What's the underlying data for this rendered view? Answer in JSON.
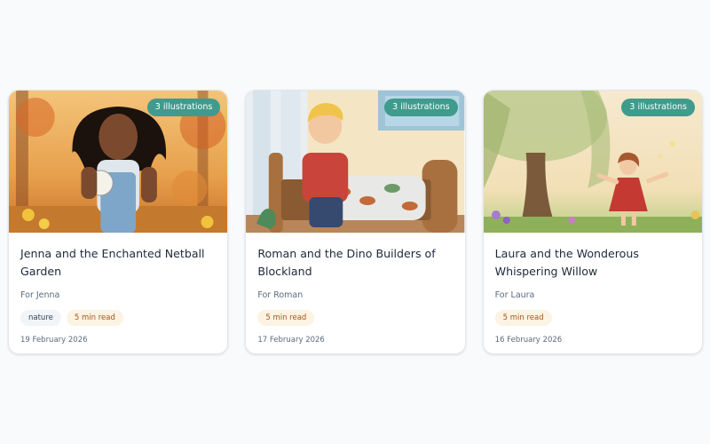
{
  "stories": [
    {
      "badge": "3 illustrations",
      "title": "Jenna and the Enchanted Netball Garden",
      "for_label": "For Jenna",
      "tags": [
        "nature",
        "5 min read"
      ],
      "date": "19 February 2026",
      "image_icon": "girl-with-netball-illustration"
    },
    {
      "badge": "3 illustrations",
      "title": "Roman and the Dino Builders of Blockland",
      "for_label": "For Roman",
      "tags": [
        "5 min read"
      ],
      "date": "17 February 2026",
      "image_icon": "boy-making-bed-illustration"
    },
    {
      "badge": "3 illustrations",
      "title": "Laura and the Wonderous Whispering Willow",
      "for_label": "For Laura",
      "tags": [
        "5 min read"
      ],
      "date": "16 February 2026",
      "image_icon": "girl-under-willow-illustration"
    }
  ],
  "colors": {
    "badge_bg": "#3f9b8c",
    "title": "#1e293b",
    "muted": "#5b6b7e",
    "time_tag_bg": "#fdf3e3",
    "time_tag_text": "#a0561a",
    "topic_tag_bg": "#f1f5f9"
  }
}
